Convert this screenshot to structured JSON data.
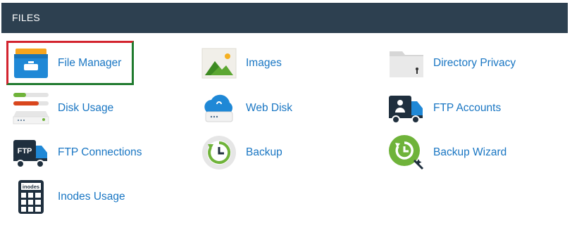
{
  "header": {
    "title": "FILES"
  },
  "items": [
    {
      "label": "File Manager",
      "icon": "file-manager-icon"
    },
    {
      "label": "Images",
      "icon": "images-icon"
    },
    {
      "label": "Directory Privacy",
      "icon": "directory-privacy-icon"
    },
    {
      "label": "Disk Usage",
      "icon": "disk-usage-icon"
    },
    {
      "label": "Web Disk",
      "icon": "web-disk-icon"
    },
    {
      "label": "FTP Accounts",
      "icon": "ftp-accounts-icon"
    },
    {
      "label": "FTP Connections",
      "icon": "ftp-connections-icon"
    },
    {
      "label": "Backup",
      "icon": "backup-icon"
    },
    {
      "label": "Backup Wizard",
      "icon": "backup-wizard-icon"
    },
    {
      "label": "Inodes Usage",
      "icon": "inodes-usage-icon"
    }
  ],
  "icon_text": {
    "ftp": "FTP",
    "inodes": "inodes"
  },
  "colors": {
    "header_bg": "#2d4050",
    "link": "#1976c3",
    "highlight_red": "#d3232e",
    "highlight_green": "#1f7a2e"
  }
}
